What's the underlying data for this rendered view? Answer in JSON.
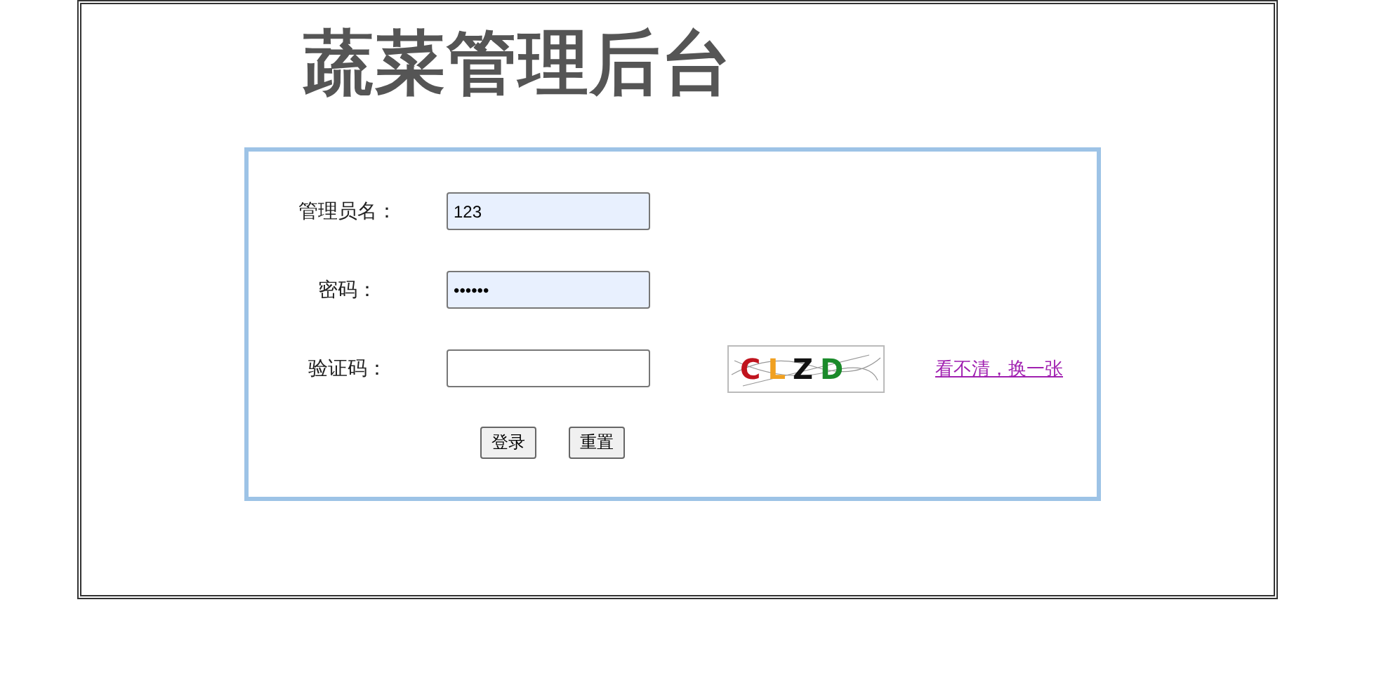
{
  "title": "蔬菜管理后台",
  "fields": [
    {
      "label": "管理员名：",
      "value": "123",
      "autofilled": true
    },
    {
      "label": "密码：",
      "value": "••••••",
      "autofilled": true
    },
    {
      "label": "验证码：",
      "autofilled": false
    }
  ],
  "captcha": {
    "chars": [
      {
        "text": "C",
        "color": "#c0141e"
      },
      {
        "text": "L",
        "color": "#f0a020"
      },
      {
        "text": "Z",
        "color": "#111111"
      },
      {
        "text": "D",
        "color": "#1a8a2a"
      }
    ]
  },
  "refresh_link": "看不清，换一张",
  "buttons": [
    "登录",
    "重置"
  ]
}
